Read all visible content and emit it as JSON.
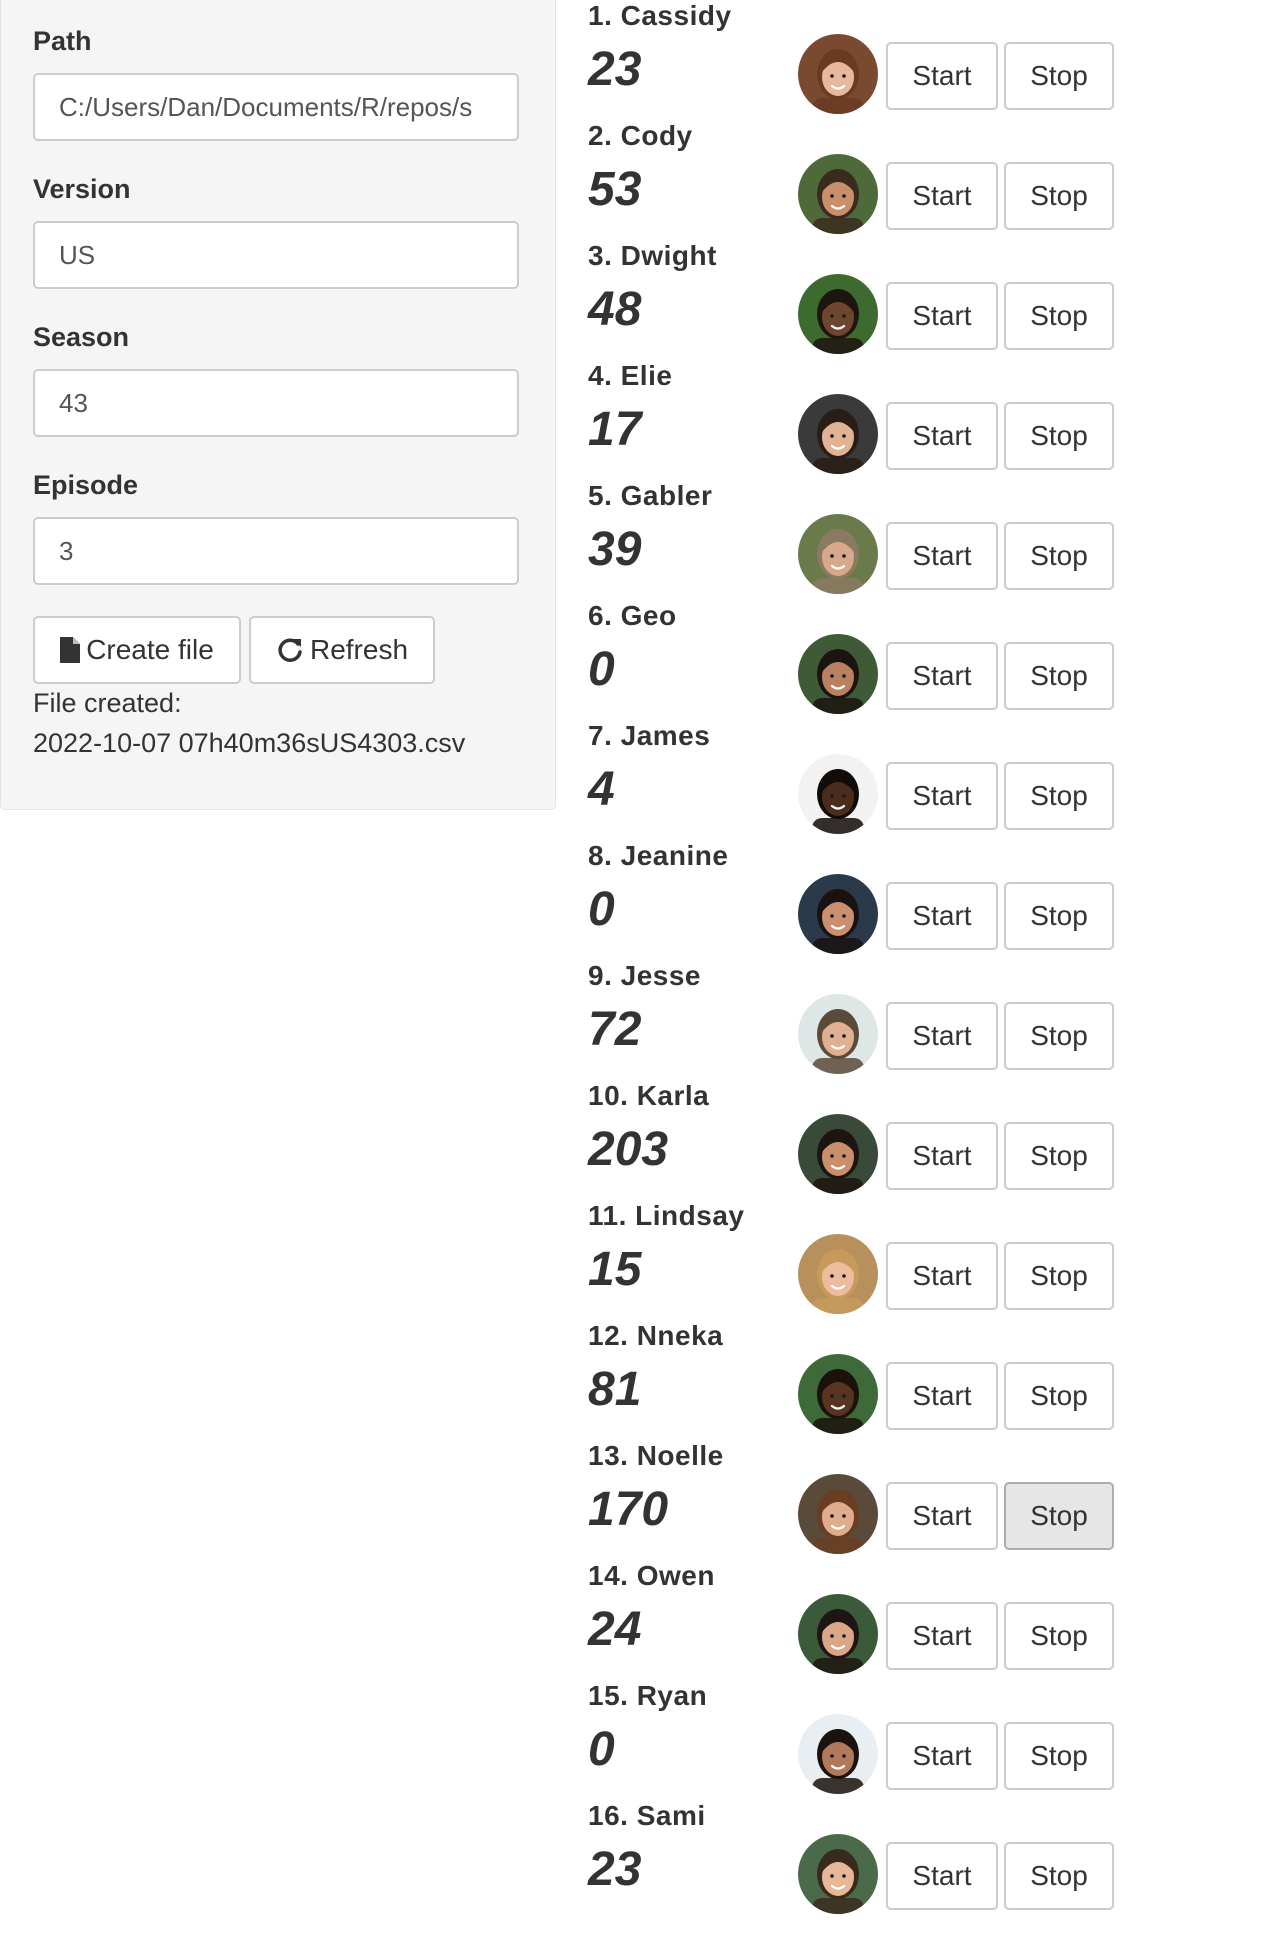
{
  "sidebar": {
    "path": {
      "label": "Path",
      "value": "C:/Users/Dan/Documents/R/repos/s"
    },
    "version": {
      "label": "Version",
      "value": "US"
    },
    "season": {
      "label": "Season",
      "value": "43"
    },
    "episode": {
      "label": "Episode",
      "value": "3"
    },
    "create_button": {
      "label": "Create file",
      "icon": "file-icon"
    },
    "refresh_button": {
      "label": "Refresh",
      "icon": "refresh-icon"
    },
    "status_label": "File created:",
    "status_file": "2022-10-07 07h40m36sUS4303.csv"
  },
  "buttons": {
    "start_label": "Start",
    "stop_label": "Stop"
  },
  "contestants": [
    {
      "label": "1. Cassidy",
      "count": "23",
      "skin": "#e8b89c",
      "hair": "#6b3a22",
      "bg": "#7a4a30"
    },
    {
      "label": "2. Cody",
      "count": "53",
      "skin": "#c98e6a",
      "hair": "#3b2a1e",
      "bg": "#4e6a3a"
    },
    {
      "label": "3. Dwight",
      "count": "48",
      "skin": "#6e4630",
      "hair": "#1e1410",
      "bg": "#3d6a2e"
    },
    {
      "label": "4. Elie",
      "count": "17",
      "skin": "#e2b294",
      "hair": "#2a1c16",
      "bg": "#3a3a3a"
    },
    {
      "label": "5. Gabler",
      "count": "39",
      "skin": "#d9a88a",
      "hair": "#8a7a60",
      "bg": "#6a7a4a"
    },
    {
      "label": "6. Geo",
      "count": "0",
      "skin": "#b98062",
      "hair": "#1c1410",
      "bg": "#3e5a36"
    },
    {
      "label": "7. James",
      "count": "4",
      "skin": "#4a2c1c",
      "hair": "#120c08",
      "bg": "#f2f2f2"
    },
    {
      "label": "8. Jeanine",
      "count": "0",
      "skin": "#c98f6e",
      "hair": "#1a1210",
      "bg": "#2a3a4a"
    },
    {
      "label": "9. Jesse",
      "count": "72",
      "skin": "#e0b092",
      "hair": "#5a4a3a",
      "bg": "#dfe6e6"
    },
    {
      "label": "10. Karla",
      "count": "203",
      "skin": "#c98e6c",
      "hair": "#1e1410",
      "bg": "#3a4a3a"
    },
    {
      "label": "11. Lindsay",
      "count": "15",
      "skin": "#ecbc9c",
      "hair": "#c79a5c",
      "bg": "#b8905c"
    },
    {
      "label": "12. Nneka",
      "count": "81",
      "skin": "#5a3422",
      "hair": "#1c120c",
      "bg": "#3e6a3a"
    },
    {
      "label": "13. Noelle",
      "count": "170",
      "skin": "#e0ac8c",
      "hair": "#6a3e22",
      "bg": "#5a4a3a"
    },
    {
      "label": "14. Owen",
      "count": "24",
      "skin": "#d9a688",
      "hair": "#1e1612",
      "bg": "#3a5a3a"
    },
    {
      "label": "15. Ryan",
      "count": "0",
      "skin": "#b07a5a",
      "hair": "#1a120e",
      "bg": "#e8eef2"
    },
    {
      "label": "16. Sami",
      "count": "23",
      "skin": "#e6b898",
      "hair": "#3a2a1e",
      "bg": "#4a6a4a"
    }
  ],
  "pressed_button": {
    "contestant_index": 12,
    "button": "stop"
  }
}
